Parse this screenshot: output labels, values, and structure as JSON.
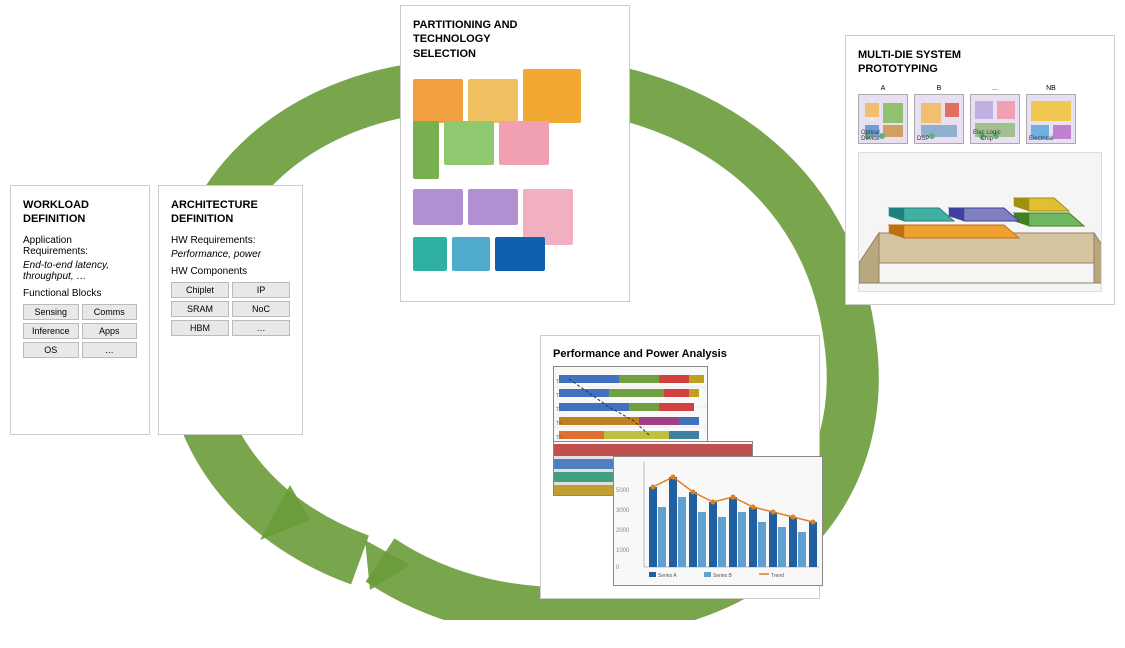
{
  "cycle": {
    "arrow_color": "#6a9c3a",
    "arrow_color_dark": "#4a7a1a"
  },
  "workload": {
    "title": "WORKLOAD\nDEFINITION",
    "section1_label": "Application\nRequirements:",
    "section1_detail": "End-to-end latency,\nthroughput, …",
    "section2_label": "Functional Blocks",
    "blocks": [
      {
        "label": "Sensing",
        "wide": false
      },
      {
        "label": "Comms",
        "wide": false
      },
      {
        "label": "Inference",
        "wide": false
      },
      {
        "label": "Apps",
        "wide": false
      },
      {
        "label": "OS",
        "wide": false
      },
      {
        "label": "…",
        "wide": false
      }
    ]
  },
  "architecture": {
    "title": "ARCHITECTURE\nDEFINITION",
    "section1_label": "HW Requirements:",
    "section1_detail": "Performance, power",
    "section2_label": "HW Components",
    "blocks": [
      {
        "label": "Chiplet",
        "wide": false
      },
      {
        "label": "IP",
        "wide": false
      },
      {
        "label": "SRAM",
        "wide": false
      },
      {
        "label": "NoC",
        "wide": false
      },
      {
        "label": "HBM",
        "wide": false
      },
      {
        "label": "…",
        "wide": false
      }
    ]
  },
  "partitioning": {
    "title": "PARTITIONING AND\nTECHNOLOGY\nSELECTION",
    "rects": [
      [
        {
          "w": 52,
          "h": 45,
          "color": "#f0a040"
        },
        {
          "w": 52,
          "h": 45,
          "color": "#f0c060"
        },
        {
          "w": 60,
          "h": 55,
          "color": "#f0b040"
        }
      ],
      [
        {
          "w": 28,
          "h": 55,
          "color": "#80b860"
        },
        {
          "w": 52,
          "h": 45,
          "color": "#90c870"
        },
        {
          "w": 52,
          "h": 45,
          "color": "#f0a0b0"
        }
      ],
      [
        {
          "w": 52,
          "h": 38,
          "color": "#b090d0"
        },
        {
          "w": 52,
          "h": 38,
          "color": "#b090d0"
        },
        {
          "w": 0,
          "h": 0,
          "color": "transparent"
        },
        {
          "w": 52,
          "h": 55,
          "color": "#f0b0c0"
        }
      ],
      [
        {
          "w": 35,
          "h": 35,
          "color": "#30b0a0"
        },
        {
          "w": 38,
          "h": 35,
          "color": "#50aacc"
        },
        {
          "w": 0,
          "h": 0,
          "color": "transparent"
        },
        {
          "w": 52,
          "h": 35,
          "color": "#1060b0"
        }
      ]
    ]
  },
  "multidie": {
    "title": "MULTI-DIE SYSTEM\nPROTOTYPING"
  },
  "performance": {
    "title": "Performance and Power Analysis"
  }
}
